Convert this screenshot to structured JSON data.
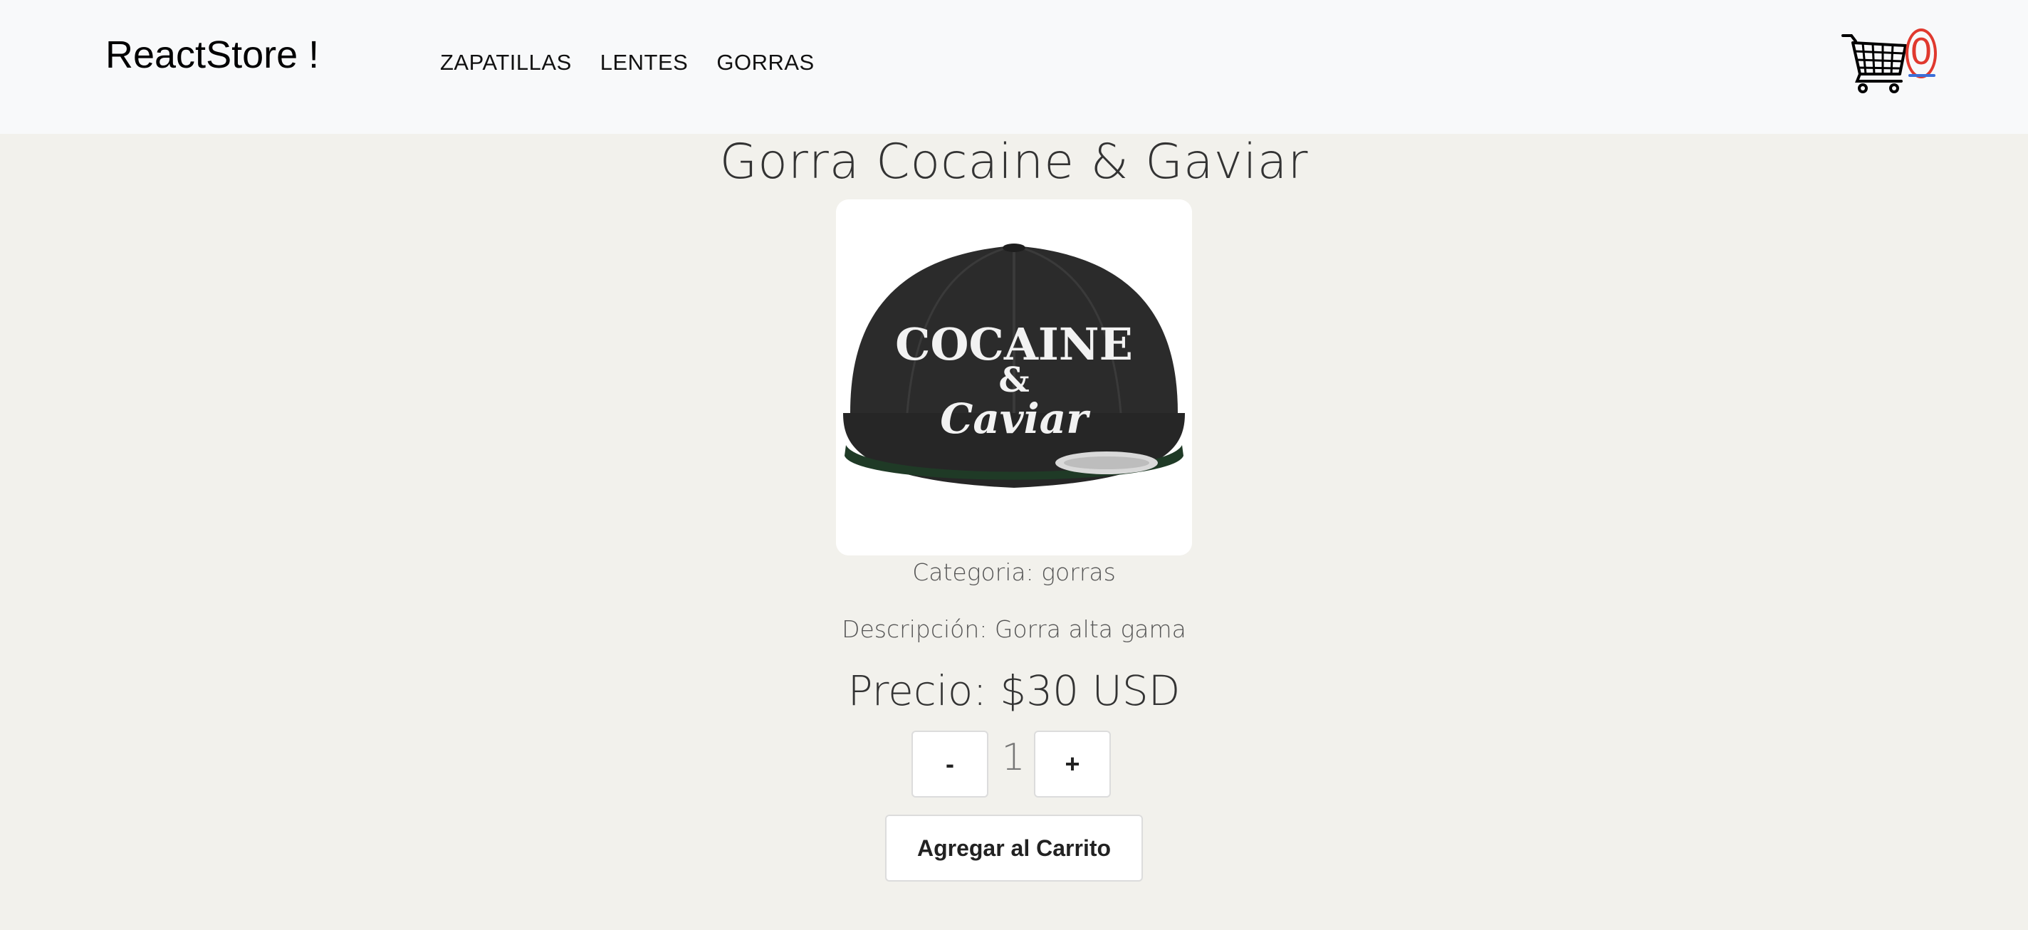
{
  "navbar": {
    "brand": "ReactStore !",
    "links": [
      "ZAPATILLAS",
      "LENTES",
      "GORRAS"
    ],
    "cart_count": "0",
    "cart_icon": "shopping-cart-icon"
  },
  "product": {
    "title": "Gorra Cocaine & Gaviar",
    "category": "Categoria: gorras",
    "description": "Descripción: Gorra alta gama",
    "price": "Precio: $30 USD",
    "image_text_line1": "COCAINE",
    "image_text_line2": "&",
    "image_text_line3": "Caviar"
  },
  "counter": {
    "minus_label": "-",
    "quantity": "1",
    "plus_label": "+"
  },
  "actions": {
    "add_to_cart_label": "Agregar al Carrito"
  },
  "colors": {
    "navbar_bg": "#f8f9fa",
    "page_bg": "#f2f1ec",
    "cart_badge": "#e0392e",
    "cart_underline": "#3b6fd8"
  }
}
